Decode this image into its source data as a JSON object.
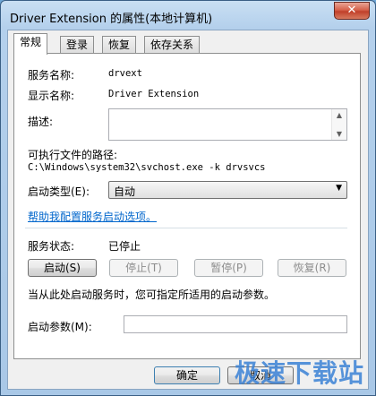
{
  "window": {
    "title": "Driver Extension 的属性(本地计算机)",
    "close_glyph": "✕"
  },
  "tabs": [
    {
      "label": "常规",
      "active": true
    },
    {
      "label": "登录",
      "active": false
    },
    {
      "label": "恢复",
      "active": false
    },
    {
      "label": "依存关系",
      "active": false
    }
  ],
  "general": {
    "service_name_label": "服务名称:",
    "service_name_value": "drvext",
    "display_name_label": "显示名称:",
    "display_name_value": "Driver Extension",
    "description_label": "描述:",
    "description_value": "",
    "exe_path_label": "可执行文件的路径:",
    "exe_path_value": "C:\\Windows\\system32\\svchost.exe -k drvsvcs",
    "startup_type_label": "启动类型(E):",
    "startup_type_value": "自动",
    "help_link": "帮助我配置服务启动选项。",
    "status_label": "服务状态:",
    "status_value": "已停止",
    "buttons": {
      "start": "启动(S)",
      "stop": "停止(T)",
      "pause": "暂停(P)",
      "resume": "恢复(R)"
    },
    "hint": "当从此处启动服务时，您可指定所适用的启动参数。",
    "start_params_label": "启动参数(M):",
    "start_params_value": ""
  },
  "footer": {
    "ok": "确定",
    "cancel": "取消"
  },
  "watermark": "极速下载站"
}
